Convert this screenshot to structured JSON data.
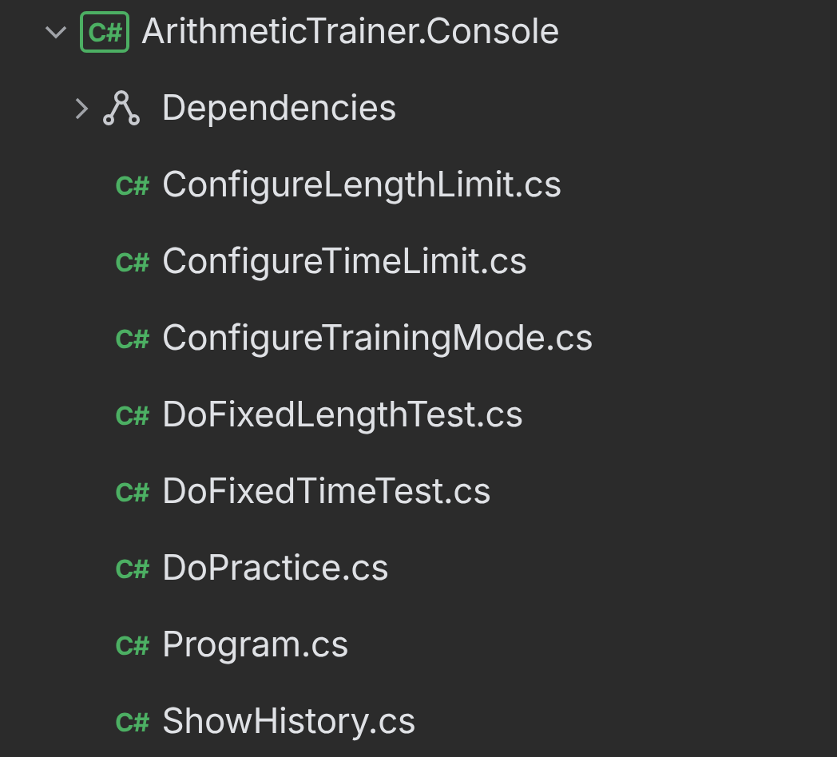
{
  "tree": [
    {
      "kind": "project",
      "badge": "C#",
      "label": "ArithmeticTrainer.Console",
      "expanded": true,
      "children": [
        {
          "kind": "dependencies",
          "label": "Dependencies",
          "expanded": false
        },
        {
          "kind": "file",
          "badge": "C#",
          "label": "ConfigureLengthLimit.cs"
        },
        {
          "kind": "file",
          "badge": "C#",
          "label": "ConfigureTimeLimit.cs"
        },
        {
          "kind": "file",
          "badge": "C#",
          "label": "ConfigureTrainingMode.cs"
        },
        {
          "kind": "file",
          "badge": "C#",
          "label": "DoFixedLengthTest.cs"
        },
        {
          "kind": "file",
          "badge": "C#",
          "label": "DoFixedTimeTest.cs"
        },
        {
          "kind": "file",
          "badge": "C#",
          "label": "DoPractice.cs"
        },
        {
          "kind": "file",
          "badge": "C#",
          "label": "Program.cs"
        },
        {
          "kind": "file",
          "badge": "C#",
          "label": "ShowHistory.cs"
        }
      ]
    }
  ]
}
